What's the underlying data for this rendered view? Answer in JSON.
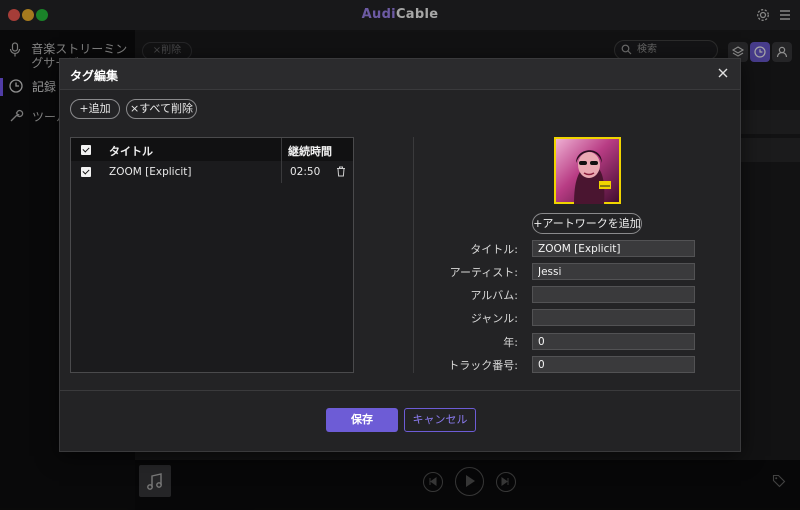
{
  "app": {
    "title_part1": "Audi",
    "title_part2": "Cable"
  },
  "sidebar": {
    "items": [
      {
        "label": "音楽ストリーミングサービス",
        "icon": "microphone-icon"
      },
      {
        "label": "記録",
        "icon": "clock-icon",
        "active": true
      },
      {
        "label": "ツール",
        "icon": "wrench-icon"
      }
    ]
  },
  "toolbar": {
    "delete_label": "×削除",
    "search_placeholder": "検索"
  },
  "dialog": {
    "title": "タグ編集",
    "add_label": "+追加",
    "delete_all_label": "×すべて削除",
    "table": {
      "headers": {
        "title": "タイトル",
        "duration": "継続時間"
      },
      "rows": [
        {
          "title": "ZOOM [Explicit]",
          "duration": "02:50",
          "checked": true
        }
      ]
    },
    "add_artwork_label": "+アートワークを追加",
    "fields": {
      "title_label": "タイトル:",
      "title_value": "ZOOM [Explicit]",
      "artist_label": "アーティスト:",
      "artist_value": "Jessi",
      "album_label": "アルバム:",
      "album_value": "",
      "genre_label": "ジャンル:",
      "genre_value": "",
      "year_label": "年:",
      "year_value": "0",
      "track_label": "トラック番号:",
      "track_value": "0"
    },
    "save_label": "保存",
    "cancel_label": "キャンセル"
  },
  "colors": {
    "accent": "#6d5cd6",
    "brand_purple": "#a78bfa"
  }
}
